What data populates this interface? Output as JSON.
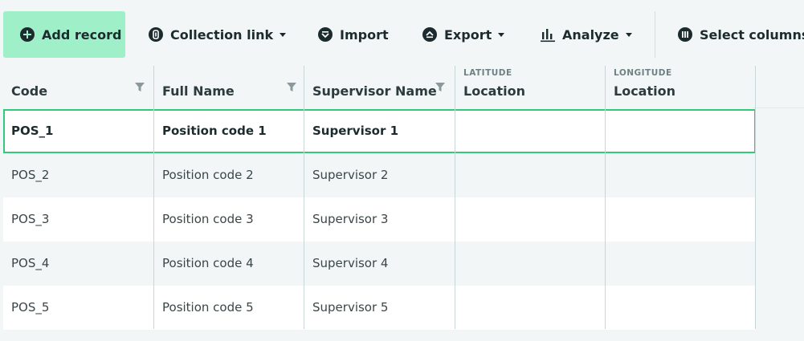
{
  "toolbar": {
    "add_record": "Add record",
    "collection_link": "Collection link",
    "import": "Import",
    "export": "Export",
    "analyze": "Analyze",
    "select_columns": "Select columns"
  },
  "columns": [
    {
      "label": "Code",
      "sublabel": "",
      "filter": true
    },
    {
      "label": "Full Name",
      "sublabel": "",
      "filter": true
    },
    {
      "label": "Supervisor Name",
      "sublabel": "",
      "filter": true
    },
    {
      "label": "Location",
      "sublabel": "LATITUDE",
      "filter": false
    },
    {
      "label": "Location",
      "sublabel": "LONGITUDE",
      "filter": false
    }
  ],
  "rows": [
    {
      "code": "POS_1",
      "full_name": "Position code 1",
      "supervisor": "Supervisor 1",
      "latitude": "",
      "longitude": "",
      "selected": true
    },
    {
      "code": "POS_2",
      "full_name": "Position code 2",
      "supervisor": "Supervisor 2",
      "latitude": "",
      "longitude": ""
    },
    {
      "code": "POS_3",
      "full_name": "Position code 3",
      "supervisor": "Supervisor 3",
      "latitude": "",
      "longitude": ""
    },
    {
      "code": "POS_4",
      "full_name": "Position code 4",
      "supervisor": "Supervisor 4",
      "latitude": "",
      "longitude": ""
    },
    {
      "code": "POS_5",
      "full_name": "Position code 5",
      "supervisor": "Supervisor 5",
      "latitude": "",
      "longitude": ""
    }
  ],
  "icons": {
    "add_record": "plus-circle-icon",
    "collection_link": "link-icon",
    "import": "import-icon",
    "export": "export-icon",
    "analyze": "bar-chart-icon",
    "select_columns": "columns-icon",
    "filter": "filter-icon"
  },
  "colors": {
    "accent": "#9ff0c9",
    "selection_border": "#33c97a",
    "text": "#1c2b2e"
  }
}
